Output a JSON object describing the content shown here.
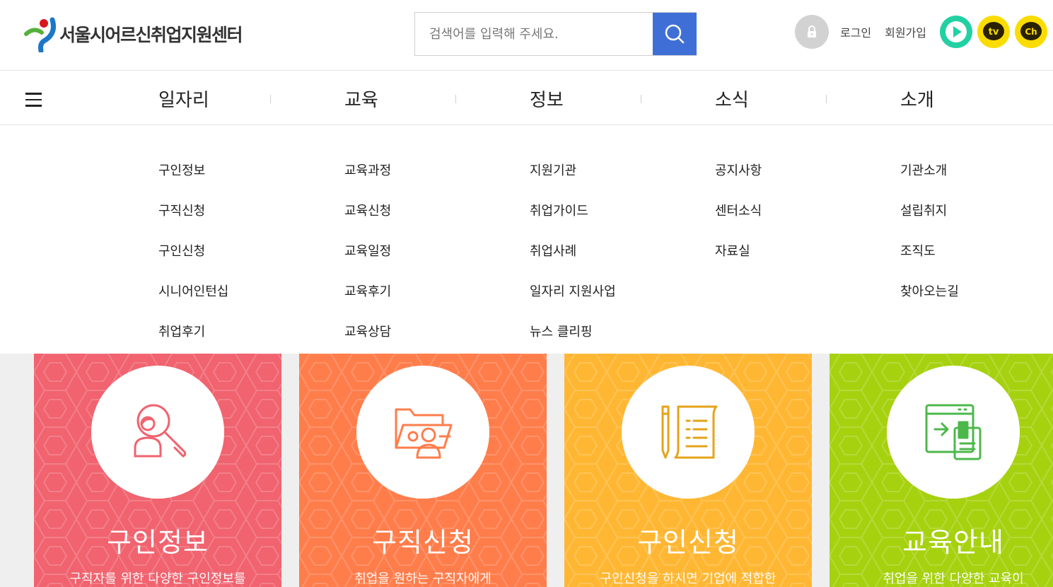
{
  "header": {
    "logo_text": "서울시어르신취업지원센터",
    "search_placeholder": "검색어를 입력해 주세요.",
    "login": "로그인",
    "signup": "회원가입",
    "sns": [
      {
        "name": "play-icon",
        "label": ""
      },
      {
        "name": "kakao-tv-icon",
        "label": "tv"
      },
      {
        "name": "kakao-channel-icon",
        "label": "Ch"
      }
    ]
  },
  "gnb": {
    "items": [
      "일자리",
      "교육",
      "정보",
      "소식",
      "소개"
    ]
  },
  "submenu": {
    "columns": [
      [
        "구인정보",
        "구직신청",
        "구인신청",
        "시니어인턴십",
        "취업후기"
      ],
      [
        "교육과정",
        "교육신청",
        "교육일정",
        "교육후기",
        "교육상담"
      ],
      [
        "지원기관",
        "취업가이드",
        "취업사례",
        "일자리 지원사업",
        "뉴스 클리핑"
      ],
      [
        "공지사항",
        "센터소식",
        "자료실"
      ],
      [
        "기관소개",
        "설립취지",
        "조직도",
        "찾아오는길"
      ]
    ]
  },
  "cards": [
    {
      "title": "구인정보",
      "desc": "구직자를 위한 다양한 구인정보를",
      "color": "#f0636f",
      "icon": "search-person-icon"
    },
    {
      "title": "구직신청",
      "desc": "취업을 원하는 구직자에게",
      "color": "#ff7d4b",
      "icon": "folder-person-icon"
    },
    {
      "title": "구인신청",
      "desc": "구인신청을 하시면 기업에 적합한",
      "color": "#ffb733",
      "icon": "document-pen-icon"
    },
    {
      "title": "교육안내",
      "desc": "취업을 위한 다양한 교육이",
      "color": "#a6d10f",
      "icon": "browser-document-icon"
    }
  ],
  "colors": {
    "search_button": "#3f6fd6",
    "kakao_yellow": "#fbdc00",
    "play_green": "#22d1a3"
  }
}
